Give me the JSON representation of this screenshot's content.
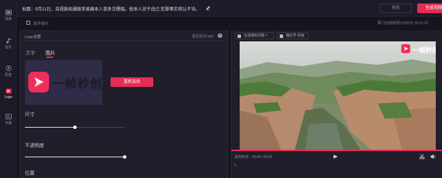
{
  "sidebar": {
    "items": [
      {
        "label": "场景",
        "icon": "scene-icon"
      },
      {
        "label": "音乐",
        "icon": "music-icon"
      },
      {
        "label": "配音",
        "icon": "dubbing-icon"
      },
      {
        "label": "Logo",
        "icon": "logo-icon"
      },
      {
        "label": "字幕",
        "icon": "subtitle-icon"
      }
    ],
    "active_index": 3
  },
  "header": {
    "title": "标题：9月11日，央视新闻通报李易峰本人曾多次嫖娼。他本人对于自己 犯罪事实供认不讳。",
    "preview_label": "预览",
    "generate_label": "生成视频"
  },
  "options": {
    "checkbox_label": "顺序播放",
    "duration_info": "当前视频预计总时长 00:01:32"
  },
  "logo_panel": {
    "title": "Logo设置",
    "link_label": "是否显示Logo",
    "help_glyph": "?",
    "tabs": [
      {
        "label": "文字"
      },
      {
        "label": "图片"
      }
    ],
    "active_tab": 1,
    "logo_text": "一帧秒创",
    "reselect_label": "重新选择",
    "size_label": "尺寸",
    "size_value": 0.5,
    "opacity_label": "不透明度",
    "opacity_value": 1.0,
    "position_label": "位置"
  },
  "preview": {
    "chips": [
      {
        "label": "在选择的问题 ×",
        "icon": "link-icon"
      },
      {
        "label": "播云号-优帧",
        "icon": "download-icon"
      }
    ],
    "watermark_text": "一帧秒创",
    "time_label": "素材时长：00:00 / 00:00",
    "cursor_mark": "1",
    "progress": 1.0
  },
  "colors": {
    "accent": "#e52d54",
    "background": "#16151f",
    "panel": "#1f1e2a"
  }
}
